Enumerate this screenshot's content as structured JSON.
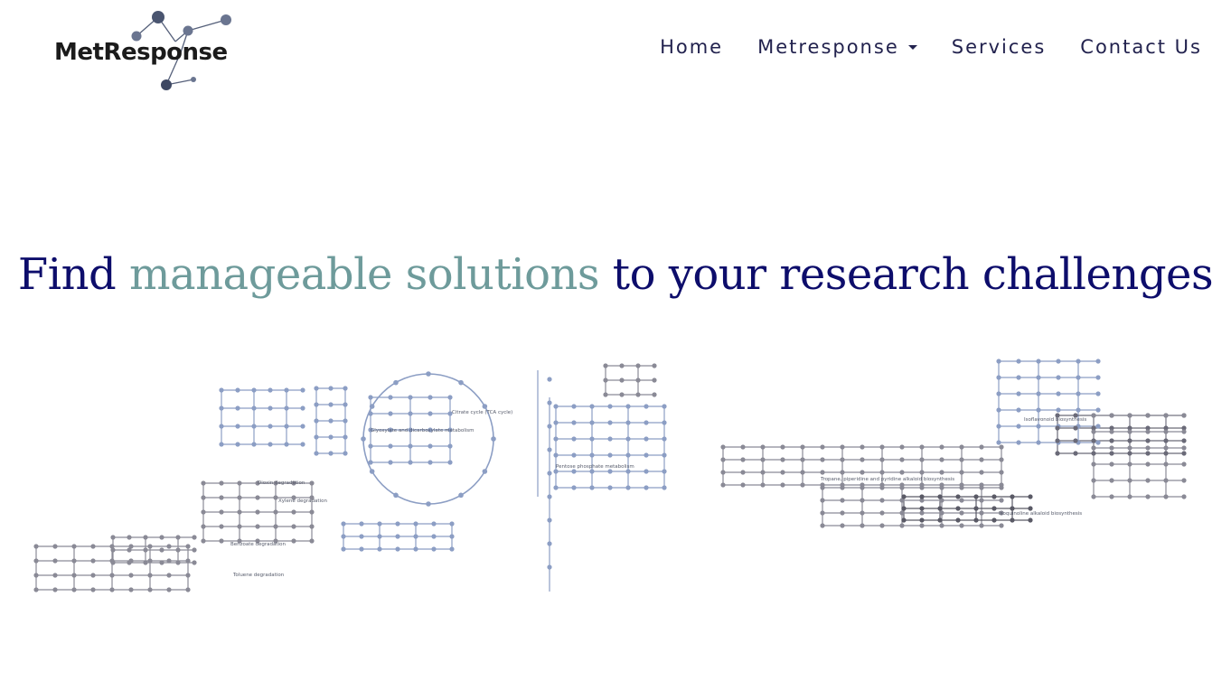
{
  "brand": {
    "name": "MetResponse"
  },
  "nav": {
    "items": [
      {
        "label": "Home"
      },
      {
        "label": "Metresponse"
      },
      {
        "label": "Services"
      },
      {
        "label": "Contact Us"
      }
    ]
  },
  "hero": {
    "headline_pre": "Find ",
    "headline_accent": "manageable solutions",
    "headline_post": " to your research challenges"
  },
  "pathway": {
    "labels": [
      "Citrate cycle (TCA cycle)",
      "Glyoxylate and dicarboxylate metabolism",
      "Pentose phosphate metabolism",
      "Dioxin degradation",
      "Xylene degradation",
      "Benzoate degradation",
      "Toluene degradation",
      "Isoquinoline alkaloid biosynthesis",
      "Tropane, piperidine and pyridine alkaloid biosynthesis",
      "Isoflavonoid biosynthesis"
    ]
  },
  "colors": {
    "navy": "#0d0d6b",
    "teal_accent": "#6e9b9b",
    "nav_text": "#22224e",
    "pathway_grey": "#8a8a96",
    "pathway_blue": "#8c9ec4"
  }
}
